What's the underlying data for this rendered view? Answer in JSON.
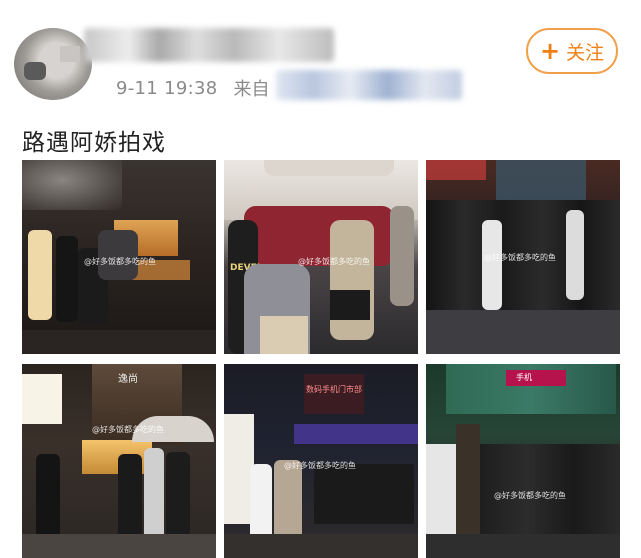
{
  "post": {
    "time": "9-11 19:38",
    "from_label": "来自",
    "text": "路遇阿娇拍戏",
    "follow_label": "关注",
    "follow_icon": "+"
  },
  "photos": [
    {
      "label": "photo-1",
      "watermark": "@好多饭都多吃的鱼"
    },
    {
      "label": "photo-2",
      "watermark": "@好多饭都多吃的鱼",
      "sign": "DEVEL"
    },
    {
      "label": "photo-3",
      "watermark": "@好多饭都多吃的鱼"
    },
    {
      "label": "photo-4",
      "watermark": "@好多饭都多吃的鱼",
      "sign": "逸尚"
    },
    {
      "label": "photo-5",
      "watermark": "@好多饭都多吃的鱼",
      "sign": "数码手机门市部"
    },
    {
      "label": "photo-6",
      "watermark": "@好多饭都多吃的鱼",
      "sign": "手机"
    }
  ],
  "colors": {
    "follow_border": "#f0a04a",
    "follow_text": "#f07f14",
    "meta_text": "#8a8a8a",
    "body_text": "#222222"
  }
}
